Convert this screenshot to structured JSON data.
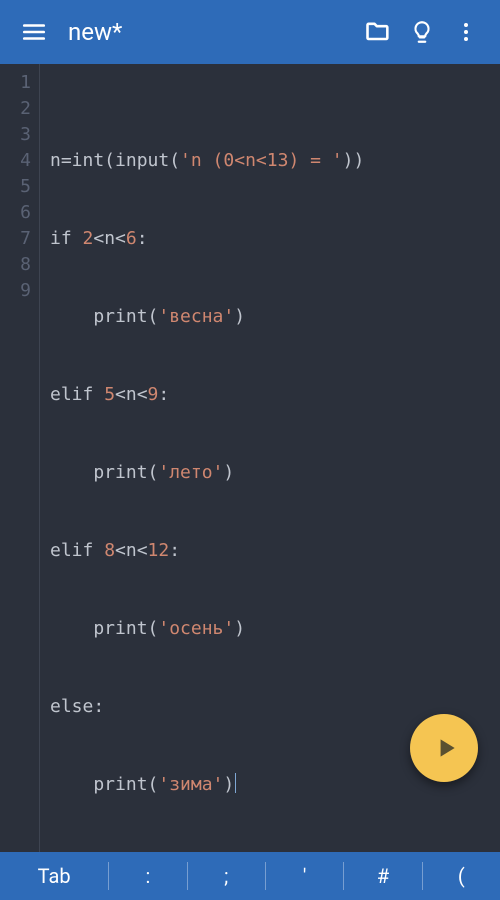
{
  "appbar": {
    "title": "new*",
    "icons": {
      "menu": "menu-icon",
      "folder": "folder-outline-icon",
      "bulb": "lightbulb-outline-icon",
      "overflow": "more-vert-icon"
    }
  },
  "editor": {
    "line_numbers": [
      "1",
      "2",
      "3",
      "4",
      "5",
      "6",
      "7",
      "8",
      "9"
    ],
    "plain_lines": [
      "n=int(input('n (0<n<13) = '))",
      "if 2<n<6:",
      "    print('весна')",
      "elif 5<n<9:",
      "    print('лето')",
      "elif 8<n<12:",
      "    print('осень')",
      "else:",
      "    print('зима')"
    ],
    "cursor_line": 9
  },
  "fab": {
    "label": "run"
  },
  "keyrow": {
    "keys": [
      "Tab",
      ":",
      ";",
      "'",
      "#",
      "("
    ]
  },
  "colors": {
    "appbar": "#2e6bb8",
    "editor_bg": "#2b303b",
    "gutter_fg": "#5a6274",
    "string": "#d08770",
    "fab": "#f5c552"
  }
}
